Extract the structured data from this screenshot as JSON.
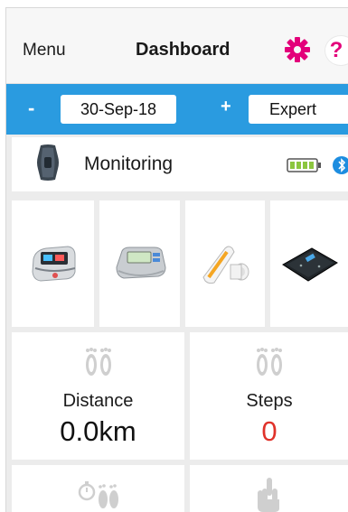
{
  "topbar": {
    "menu_label": "Menu",
    "title": "Dashboard",
    "settings_icon": "gear-icon",
    "help_label": "?",
    "accent_color": "#e3007a"
  },
  "datebar": {
    "prev_label": "-",
    "date": "30-Sep-18",
    "next_label": "+",
    "mode": "Expert",
    "bar_color": "#2a9be0"
  },
  "monitoring": {
    "label": "Monitoring",
    "device_icon": "fitness-band-icon",
    "battery_icon": "battery-icon",
    "connection_icon": "bluetooth-icon"
  },
  "devices": [
    {
      "icon": "pulse-oximeter-icon"
    },
    {
      "icon": "blood-pressure-monitor-icon"
    },
    {
      "icon": "spirometer-icon"
    },
    {
      "icon": "weighing-scale-icon"
    }
  ],
  "tiles": [
    {
      "label": "Distance",
      "value": "0.0km",
      "icon": "footprints-icon"
    },
    {
      "label": "Steps",
      "value": "0",
      "icon": "footprints-icon",
      "value_color": "#e0322a"
    },
    {
      "icon": "stopwatch-footprints-icon"
    },
    {
      "icon": "hand-icon"
    }
  ]
}
